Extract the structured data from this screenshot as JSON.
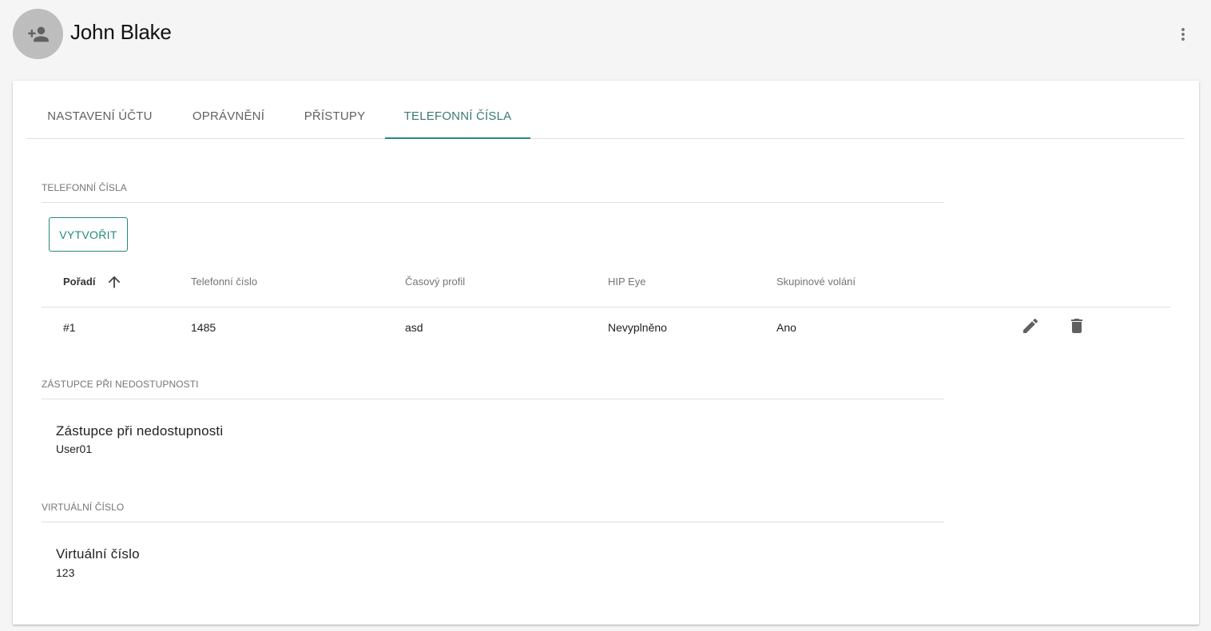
{
  "header": {
    "title": "John Blake",
    "avatar_icon": "person-add-icon",
    "more_icon": "more-vert-icon"
  },
  "tabs": [
    {
      "label": "NASTAVENÍ ÚČTU",
      "active": false
    },
    {
      "label": "OPRÁVNĚNÍ",
      "active": false
    },
    {
      "label": "PŘÍSTUPY",
      "active": false
    },
    {
      "label": "TELEFONNÍ ČÍSLA",
      "active": true
    }
  ],
  "phone_section": {
    "label": "TELEFONNÍ ČÍSLA",
    "create_label": "VYTVOŘIT",
    "columns": [
      "Pořadí",
      "Telefonní číslo",
      "Časový profil",
      "HIP Eye",
      "Skupinové volání"
    ],
    "rows": [
      {
        "order": "#1",
        "number": "1485",
        "profile": "asd",
        "hip_eye": "Nevyplněno",
        "group_call": "Ano"
      }
    ]
  },
  "substitute_section": {
    "label": "ZÁSTUPCE PŘI NEDOSTUPNOSTI",
    "field_label": "Zástupce při nedostupnosti",
    "field_value": "User01"
  },
  "virtual_section": {
    "label": "VIRTUÁLNÍ ČÍSLO",
    "field_label": "Virtuální číslo",
    "field_value": "123"
  },
  "colors": {
    "accent": "#26897a",
    "background": "#f5f5f5",
    "avatar": "#bdbdbd"
  }
}
